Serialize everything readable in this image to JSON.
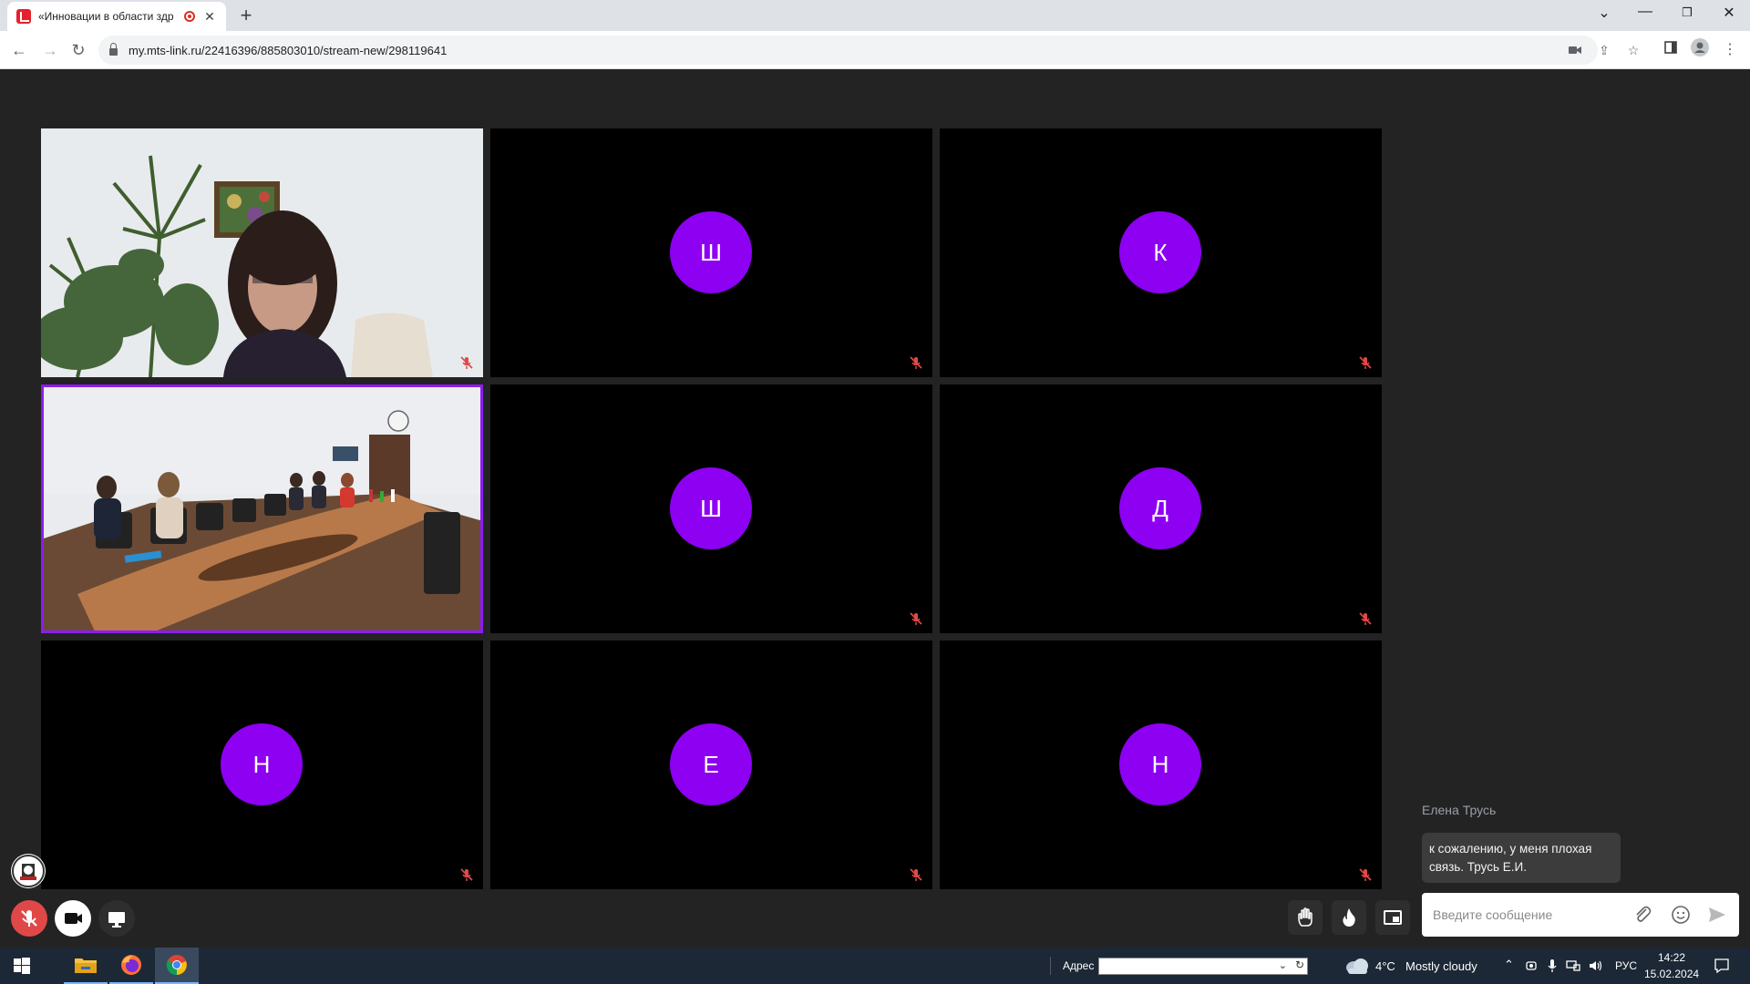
{
  "browser": {
    "tab_title": "«Инновации в области здр",
    "url": "my.mts-link.ru/22416396/885803010/stream-new/298119641"
  },
  "grid": {
    "tiles": [
      {
        "kind": "video",
        "scene": "presenter-office",
        "muted": true
      },
      {
        "kind": "avatar",
        "initial": "Ш",
        "muted": true
      },
      {
        "kind": "avatar",
        "initial": "К",
        "muted": true
      },
      {
        "kind": "video",
        "scene": "conference-room",
        "muted": false,
        "active_speaker": true
      },
      {
        "kind": "avatar",
        "initial": "Ш",
        "muted": true
      },
      {
        "kind": "avatar",
        "initial": "Д",
        "muted": true
      },
      {
        "kind": "avatar",
        "initial": "Н",
        "muted": true
      },
      {
        "kind": "avatar",
        "initial": "Е",
        "muted": true
      },
      {
        "kind": "avatar",
        "initial": "Н",
        "muted": true
      }
    ],
    "avatar_color": "#8d00f2",
    "active_border_color": "#8d1cf0"
  },
  "chat": {
    "author": "Елена Трусь",
    "message": "к сожалению, у меня плохая связь. Трусь Е.И.",
    "input_placeholder": "Введите сообщение"
  },
  "controls": {
    "mic_state": "muted",
    "mic_color": "#e04848"
  },
  "taskbar": {
    "address_label": "Адрес",
    "weather_temp": "4°C",
    "weather_text": "Mostly cloudy",
    "language": "РУС",
    "time": "14:22",
    "date": "15.02.2024"
  },
  "icons": [
    "mts-favicon",
    "record-icon",
    "close-tab-icon",
    "new-tab-icon",
    "minimize-icon",
    "maximize-icon",
    "close-window-icon",
    "back-icon",
    "forward-icon",
    "reload-icon",
    "lock-icon",
    "camera-icon",
    "share-icon",
    "star-icon",
    "sidepanel-icon",
    "profile-icon",
    "menu-icon",
    "mic-off-icon",
    "camera-on-icon",
    "screen-share-icon",
    "raise-hand-icon",
    "reaction-icon",
    "pip-icon",
    "attach-icon",
    "emoji-icon",
    "send-icon",
    "windows-start-icon",
    "explorer-icon",
    "firefox-icon",
    "chrome-icon",
    "weather-icon"
  ]
}
